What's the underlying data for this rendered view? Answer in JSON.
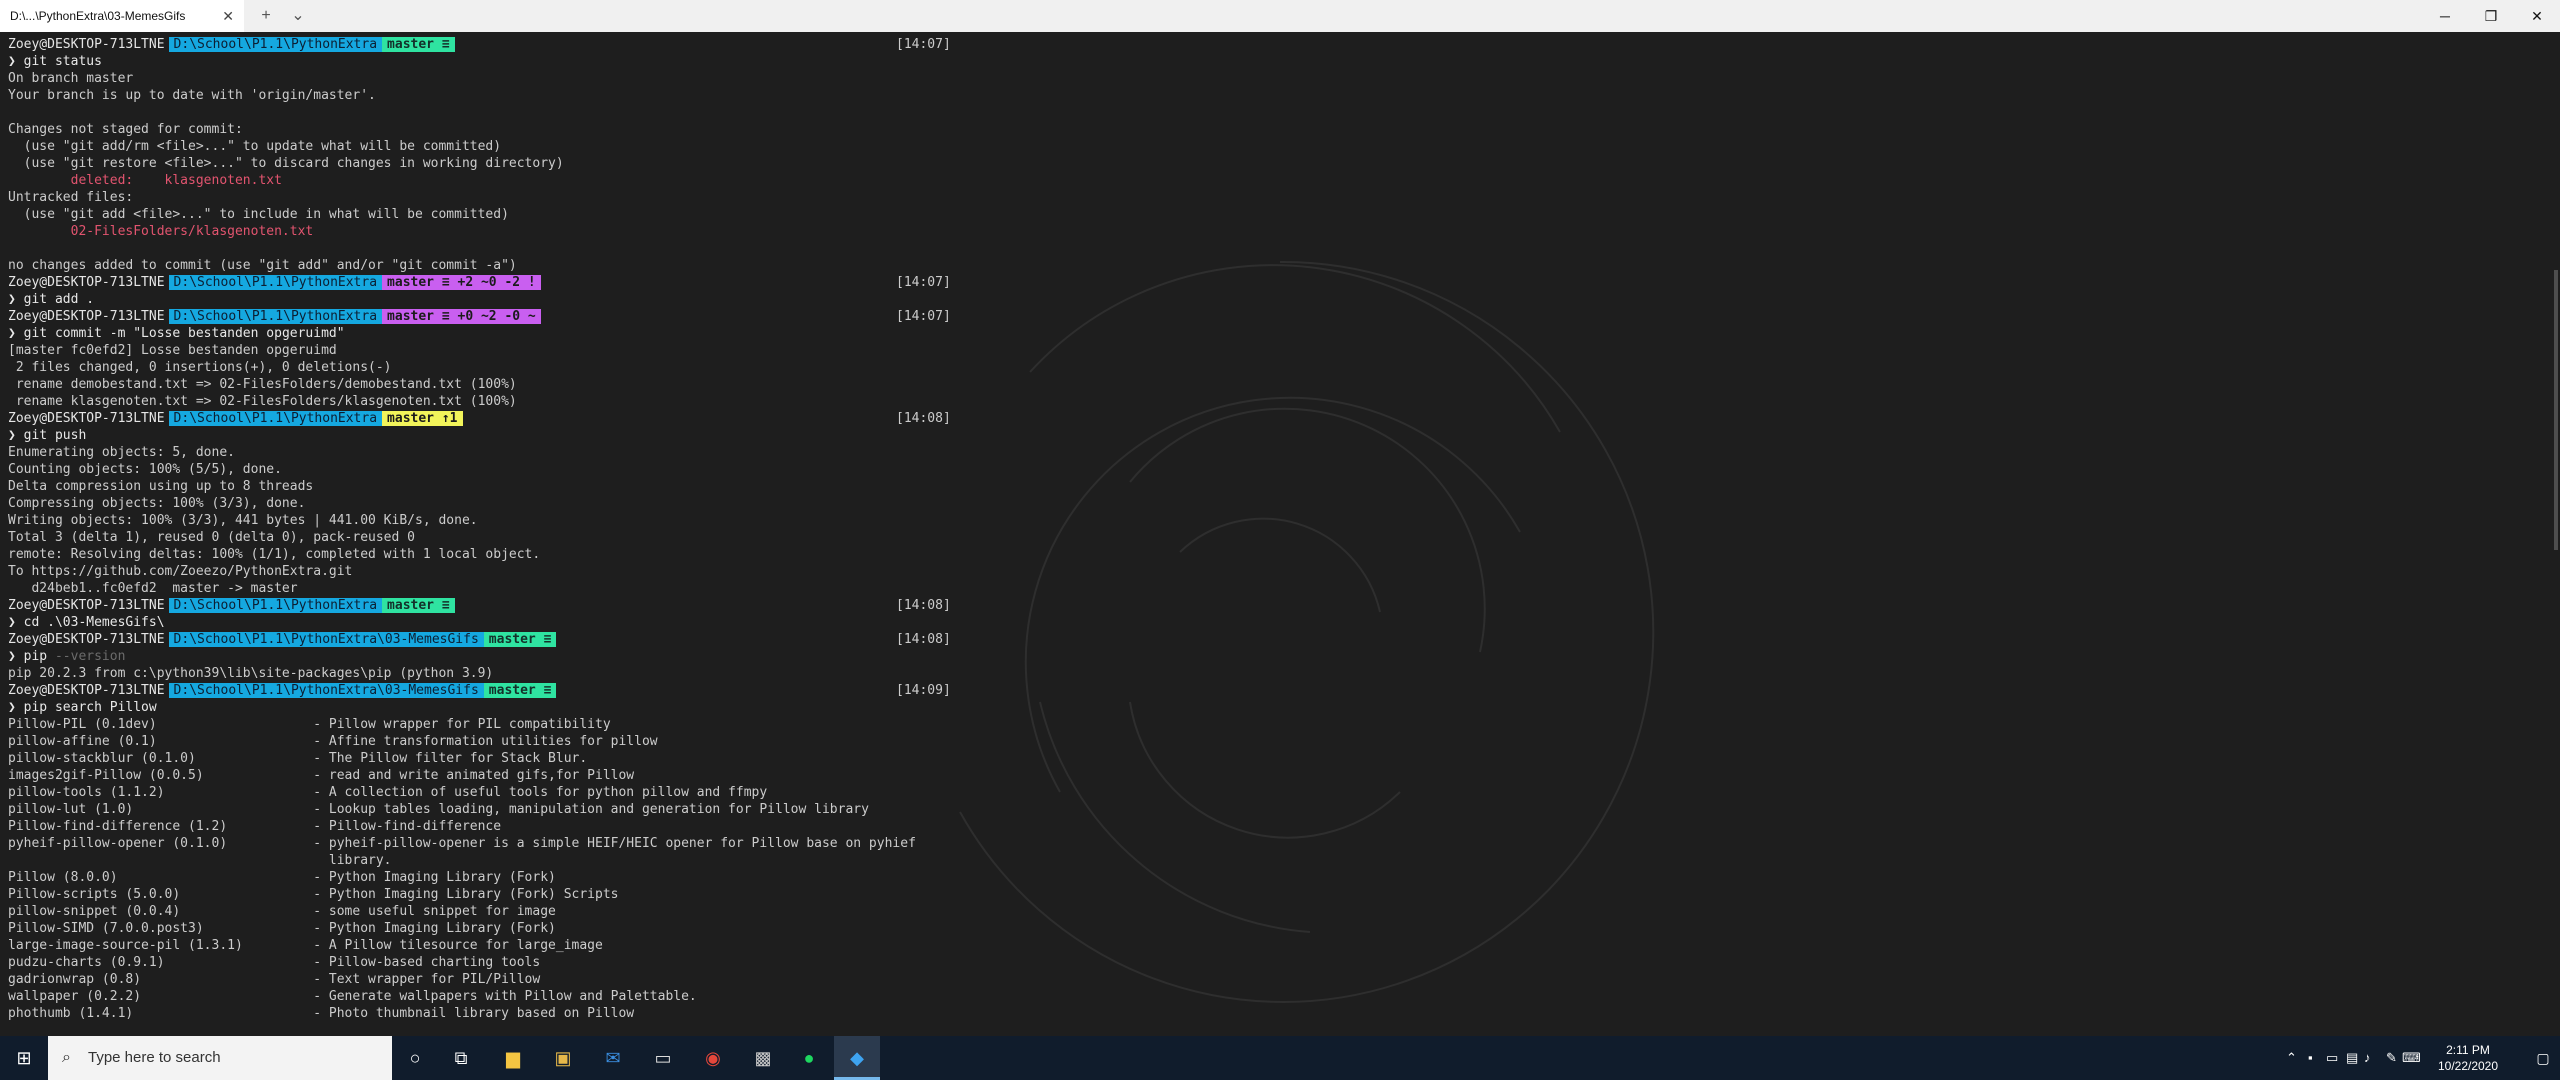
{
  "window": {
    "tab_title": "D:\\...\\PythonExtra\\03-MemesGifs",
    "tab_close": "✕",
    "new_tab": "+",
    "dropdown": "⌄",
    "minimize": "─",
    "maximize": "❐",
    "close": "✕"
  },
  "terminal": {
    "lines": [
      {
        "kind": "prompt",
        "user": "Zoey@DESKTOP-713LTNE",
        "path": "D:\\School\\P1.1\\PythonExtra",
        "git": "master ≡",
        "git_state": "clean",
        "time": "[14:07]"
      },
      {
        "kind": "cmd",
        "cmd": "git",
        "args": " status",
        "argstyle": "plain"
      },
      {
        "kind": "out",
        "text": "On branch master"
      },
      {
        "kind": "out",
        "text": "Your branch is up to date with 'origin/master'."
      },
      {
        "kind": "out",
        "text": ""
      },
      {
        "kind": "out",
        "text": "Changes not staged for commit:"
      },
      {
        "kind": "out",
        "text": "  (use \"git add/rm <file>...\" to update what will be committed)"
      },
      {
        "kind": "out",
        "text": "  (use \"git restore <file>...\" to discard changes in working directory)"
      },
      {
        "kind": "red",
        "text": "        deleted:    klasgenoten.txt"
      },
      {
        "kind": "out",
        "text": "Untracked files:"
      },
      {
        "kind": "out",
        "text": "  (use \"git add <file>...\" to include in what will be committed)"
      },
      {
        "kind": "red",
        "text": "        02-FilesFolders/klasgenoten.txt"
      },
      {
        "kind": "out",
        "text": ""
      },
      {
        "kind": "out",
        "text": "no changes added to commit (use \"git add\" and/or \"git commit -a\")"
      },
      {
        "kind": "prompt",
        "user": "Zoey@DESKTOP-713LTNE",
        "path": "D:\\School\\P1.1\\PythonExtra",
        "git": "master ≡ +2 ~0 -2 !",
        "git_state": "dirty",
        "time": "[14:07]"
      },
      {
        "kind": "cmd",
        "cmd": "git",
        "args": " add .",
        "argstyle": "plain"
      },
      {
        "kind": "prompt",
        "user": "Zoey@DESKTOP-713LTNE",
        "path": "D:\\School\\P1.1\\PythonExtra",
        "git": "master ≡ +0 ~2 -0 ~",
        "git_state": "dirty",
        "time": "[14:07]"
      },
      {
        "kind": "cmd",
        "cmd": "git",
        "args": " commit -m \"Losse bestanden opgeruimd\"",
        "argstyle": "plain"
      },
      {
        "kind": "out",
        "text": "[master fc0efd2] Losse bestanden opgeruimd"
      },
      {
        "kind": "out",
        "text": " 2 files changed, 0 insertions(+), 0 deletions(-)"
      },
      {
        "kind": "out",
        "text": " rename demobestand.txt => 02-FilesFolders/demobestand.txt (100%)"
      },
      {
        "kind": "out",
        "text": " rename klasgenoten.txt => 02-FilesFolders/klasgenoten.txt (100%)"
      },
      {
        "kind": "prompt",
        "user": "Zoey@DESKTOP-713LTNE",
        "path": "D:\\School\\P1.1\\PythonExtra",
        "git": "master ↑1",
        "git_state": "ahead",
        "time": "[14:08]"
      },
      {
        "kind": "cmd",
        "cmd": "git",
        "args": " push",
        "argstyle": "plain"
      },
      {
        "kind": "out",
        "text": "Enumerating objects: 5, done."
      },
      {
        "kind": "out",
        "text": "Counting objects: 100% (5/5), done."
      },
      {
        "kind": "out",
        "text": "Delta compression using up to 8 threads"
      },
      {
        "kind": "out",
        "text": "Compressing objects: 100% (3/3), done."
      },
      {
        "kind": "out",
        "text": "Writing objects: 100% (3/3), 441 bytes | 441.00 KiB/s, done."
      },
      {
        "kind": "out",
        "text": "Total 3 (delta 1), reused 0 (delta 0), pack-reused 0"
      },
      {
        "kind": "out",
        "text": "remote: Resolving deltas: 100% (1/1), completed with 1 local object."
      },
      {
        "kind": "out",
        "text": "To https://github.com/Zoeezo/PythonExtra.git"
      },
      {
        "kind": "out",
        "text": "   d24beb1..fc0efd2  master -> master"
      },
      {
        "kind": "prompt",
        "user": "Zoey@DESKTOP-713LTNE",
        "path": "D:\\School\\P1.1\\PythonExtra",
        "git": "master ≡",
        "git_state": "clean",
        "time": "[14:08]"
      },
      {
        "kind": "cmd",
        "cmd": "cd",
        "args": " .\\03-MemesGifs\\",
        "argstyle": "plain"
      },
      {
        "kind": "prompt",
        "user": "Zoey@DESKTOP-713LTNE",
        "path": "D:\\School\\P1.1\\PythonExtra\\03-MemesGifs",
        "git": "master ≡",
        "git_state": "clean",
        "time": "[14:08]"
      },
      {
        "kind": "cmd",
        "cmd": "pip",
        "args": " --version",
        "argstyle": "dim"
      },
      {
        "kind": "out",
        "text": "pip 20.2.3 from c:\\python39\\lib\\site-packages\\pip (python 3.9)"
      },
      {
        "kind": "prompt",
        "user": "Zoey@DESKTOP-713LTNE",
        "path": "D:\\School\\P1.1\\PythonExtra\\03-MemesGifs",
        "git": "master ≡",
        "git_state": "clean",
        "time": "[14:09]"
      },
      {
        "kind": "cmd",
        "cmd": "pip",
        "args": " search Pillow",
        "argstyle": "plain"
      },
      {
        "kind": "out",
        "text": "Pillow-PIL (0.1dev)                    - Pillow wrapper for PIL compatibility"
      },
      {
        "kind": "out",
        "text": "pillow-affine (0.1)                    - Affine transformation utilities for pillow"
      },
      {
        "kind": "out",
        "text": "pillow-stackblur (0.1.0)               - The Pillow filter for Stack Blur."
      },
      {
        "kind": "out",
        "text": "images2gif-Pillow (0.0.5)              - read and write animated gifs,for Pillow"
      },
      {
        "kind": "out",
        "text": "pillow-tools (1.1.2)                   - A collection of useful tools for python pillow and ffmpy"
      },
      {
        "kind": "out",
        "text": "pillow-lut (1.0)                       - Lookup tables loading, manipulation and generation for Pillow library"
      },
      {
        "kind": "out",
        "text": "Pillow-find-difference (1.2)           - Pillow-find-difference"
      },
      {
        "kind": "out",
        "text": "pyheif-pillow-opener (0.1.0)           - pyheif-pillow-opener is a simple HEIF/HEIC opener for Pillow base on pyhief"
      },
      {
        "kind": "out",
        "text": "                                         library."
      },
      {
        "kind": "out",
        "text": "Pillow (8.0.0)                         - Python Imaging Library (Fork)"
      },
      {
        "kind": "out",
        "text": "Pillow-scripts (5.0.0)                 - Python Imaging Library (Fork) Scripts"
      },
      {
        "kind": "out",
        "text": "pillow-snippet (0.0.4)                 - some useful snippet for image"
      },
      {
        "kind": "out",
        "text": "Pillow-SIMD (7.0.0.post3)              - Python Imaging Library (Fork)"
      },
      {
        "kind": "out",
        "text": "large-image-source-pil (1.3.1)         - A Pillow tilesource for large_image"
      },
      {
        "kind": "out",
        "text": "pudzu-charts (0.9.1)                   - Pillow-based charting tools"
      },
      {
        "kind": "out",
        "text": "gadrionwrap (0.8)                      - Text wrapper for PIL/Pillow"
      },
      {
        "kind": "out",
        "text": "wallpaper (0.2.2)                      - Generate wallpapers with Pillow and Palettable."
      },
      {
        "kind": "out",
        "text": "phothumb (1.4.1)                       - Photo thumbnail library based on Pillow"
      }
    ]
  },
  "taskbar": {
    "search_placeholder": "Type here to search",
    "time": "2:11 PM",
    "date": "10/22/2020"
  },
  "colors": {
    "path_segment": "#15a8e0",
    "git_clean": "#2fe3a1",
    "git_dirty": "#c95ff0",
    "git_ahead": "#f2f45a",
    "deleted_text": "#e2546f"
  }
}
